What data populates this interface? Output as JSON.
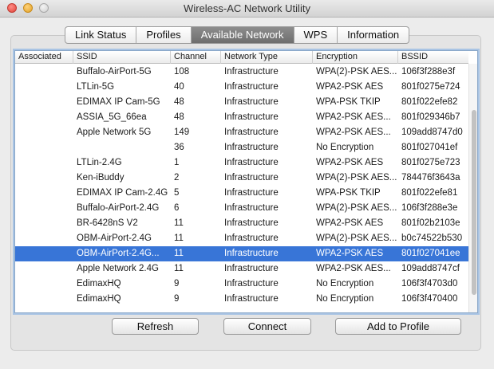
{
  "window": {
    "title": "Wireless-AC Network Utility"
  },
  "tabs": [
    {
      "label": "Link Status",
      "active": false
    },
    {
      "label": "Profiles",
      "active": false
    },
    {
      "label": "Available Network",
      "active": true
    },
    {
      "label": "WPS",
      "active": false
    },
    {
      "label": "Information",
      "active": false
    }
  ],
  "table": {
    "columns": {
      "associated": "Associated",
      "ssid": "SSID",
      "channel": "Channel",
      "network_type": "Network Type",
      "encryption": "Encryption",
      "bssid": "BSSID"
    },
    "rows": [
      {
        "associated": "",
        "ssid": "Buffalo-AirPort-5G",
        "channel": "108",
        "network_type": "Infrastructure",
        "encryption": "WPA(2)-PSK AES...",
        "bssid": "106f3f288e3f"
      },
      {
        "associated": "",
        "ssid": "LTLin-5G",
        "channel": "40",
        "network_type": "Infrastructure",
        "encryption": "WPA2-PSK AES",
        "bssid": "801f0275e724"
      },
      {
        "associated": "",
        "ssid": "EDIMAX IP Cam-5G",
        "channel": "48",
        "network_type": "Infrastructure",
        "encryption": "WPA-PSK TKIP",
        "bssid": "801f022efe82"
      },
      {
        "associated": "",
        "ssid": "ASSIA_5G_66ea",
        "channel": "48",
        "network_type": "Infrastructure",
        "encryption": "WPA2-PSK AES...",
        "bssid": "801f029346b7"
      },
      {
        "associated": "",
        "ssid": "Apple Network 5G",
        "channel": "149",
        "network_type": "Infrastructure",
        "encryption": "WPA2-PSK AES...",
        "bssid": "109add8747d0"
      },
      {
        "associated": "",
        "ssid": "",
        "channel": "36",
        "network_type": "Infrastructure",
        "encryption": "No Encryption",
        "bssid": "801f027041ef"
      },
      {
        "associated": "",
        "ssid": "LTLin-2.4G",
        "channel": "1",
        "network_type": "Infrastructure",
        "encryption": "WPA2-PSK AES",
        "bssid": "801f0275e723"
      },
      {
        "associated": "",
        "ssid": "Ken-iBuddy",
        "channel": "2",
        "network_type": "Infrastructure",
        "encryption": "WPA(2)-PSK AES...",
        "bssid": "784476f3643a"
      },
      {
        "associated": "",
        "ssid": "EDIMAX IP Cam-2.4G",
        "channel": "5",
        "network_type": "Infrastructure",
        "encryption": "WPA-PSK TKIP",
        "bssid": "801f022efe81"
      },
      {
        "associated": "",
        "ssid": "Buffalo-AirPort-2.4G",
        "channel": "6",
        "network_type": "Infrastructure",
        "encryption": "WPA(2)-PSK AES...",
        "bssid": "106f3f288e3e"
      },
      {
        "associated": "",
        "ssid": "BR-6428nS V2",
        "channel": "11",
        "network_type": "Infrastructure",
        "encryption": "WPA2-PSK AES",
        "bssid": "801f02b2103e"
      },
      {
        "associated": "",
        "ssid": "OBM-AirPort-2.4G",
        "channel": "11",
        "network_type": "Infrastructure",
        "encryption": "WPA(2)-PSK AES...",
        "bssid": "b0c74522b530"
      },
      {
        "associated": "",
        "ssid": "OBM-AirPort-2.4G...",
        "channel": "11",
        "network_type": "Infrastructure",
        "encryption": "WPA2-PSK AES",
        "bssid": "801f027041ee",
        "selected": true
      },
      {
        "associated": "",
        "ssid": "Apple Network 2.4G",
        "channel": "11",
        "network_type": "Infrastructure",
        "encryption": "WPA2-PSK AES...",
        "bssid": "109add8747cf"
      },
      {
        "associated": "",
        "ssid": "EdimaxHQ",
        "channel": "9",
        "network_type": "Infrastructure",
        "encryption": "No Encryption",
        "bssid": "106f3f4703d0"
      },
      {
        "associated": "",
        "ssid": "EdimaxHQ",
        "channel": "9",
        "network_type": "Infrastructure",
        "encryption": "No Encryption",
        "bssid": "106f3f470400"
      }
    ]
  },
  "buttons": {
    "refresh": "Refresh",
    "connect": "Connect",
    "add_to_profile": "Add to Profile"
  },
  "colors": {
    "selection": "#3875d7",
    "active_tab": "#7a7a7a"
  }
}
